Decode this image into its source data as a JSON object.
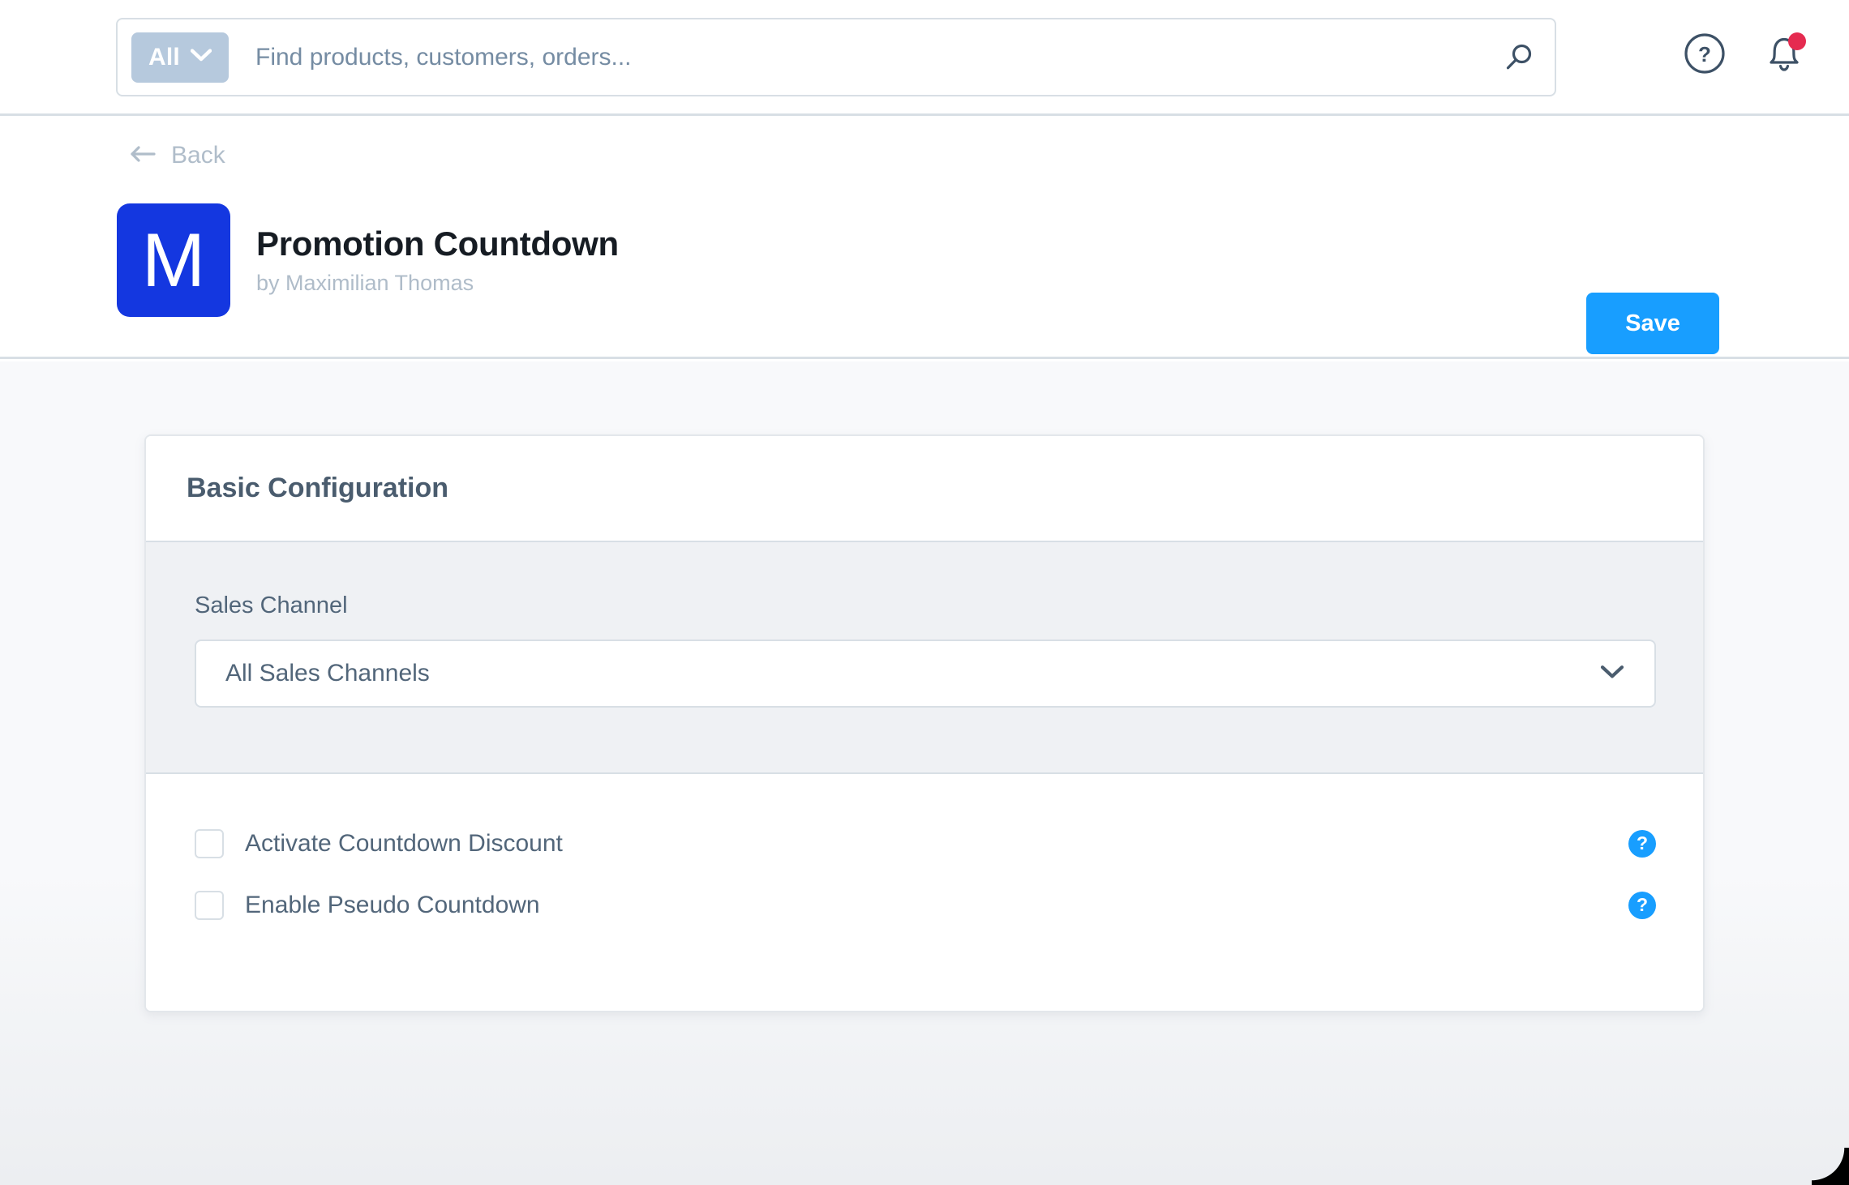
{
  "topbar": {
    "scope": {
      "label": "All",
      "icon": "chevron-down-icon"
    },
    "search": {
      "placeholder": "Find products, customers, orders...",
      "value": "",
      "icon": "search-icon"
    },
    "actions": [
      {
        "name": "help-icon",
        "label": "Help"
      },
      {
        "name": "notification-bell-icon",
        "label": "Notifications",
        "badge": true
      }
    ]
  },
  "page_header": {
    "back": {
      "label": "Back",
      "icon": "arrow-left-icon"
    },
    "app": {
      "icon_letter": "M",
      "icon_color": "#1437e0",
      "title": "Promotion Countdown",
      "author": "by Maximilian Thomas"
    },
    "save_label": "Save",
    "save_color": "#189eff"
  },
  "card": {
    "title": "Basic Configuration",
    "sales_channel": {
      "label": "Sales Channel",
      "value": "All Sales Channels",
      "icon": "chevron-down-icon"
    },
    "checkboxes": [
      {
        "label": "Activate Countdown Discount",
        "checked": false,
        "help": "?",
        "help_color": "#189eff"
      },
      {
        "label": "Enable Pseudo Countdown",
        "checked": false,
        "help": "?",
        "help_color": "#189eff"
      }
    ]
  }
}
